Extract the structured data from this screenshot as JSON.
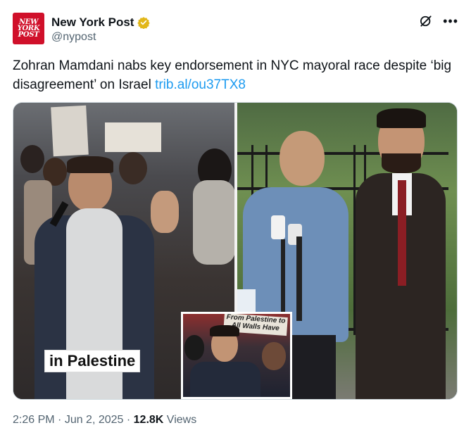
{
  "account": {
    "name": "New York Post",
    "handle": "@nypost",
    "logo_text": [
      "NEW",
      "YORK",
      "POST"
    ],
    "verified": true,
    "avatar_color": "#d0102a"
  },
  "post": {
    "text": "Zohran Mamdani nabs key endorsement in NYC mayoral race despite ‘big disagreement’ on Israel",
    "link": "trib.al/ou37TX8"
  },
  "media": {
    "left_caption": "in Palestine",
    "inset_sign": "From Palestine to All Walls Have"
  },
  "footer": {
    "time": "2:26 PM",
    "separator": " · ",
    "date": "Jun 2, 2025",
    "views_count": "12.8K",
    "views_label": " Views"
  },
  "icons": {
    "grok": "grok-icon",
    "more": "more-icon",
    "verified": "verified-badge-icon"
  },
  "colors": {
    "link": "#1d9bf0",
    "muted": "#536471",
    "gold_badge": "#e2b719"
  }
}
